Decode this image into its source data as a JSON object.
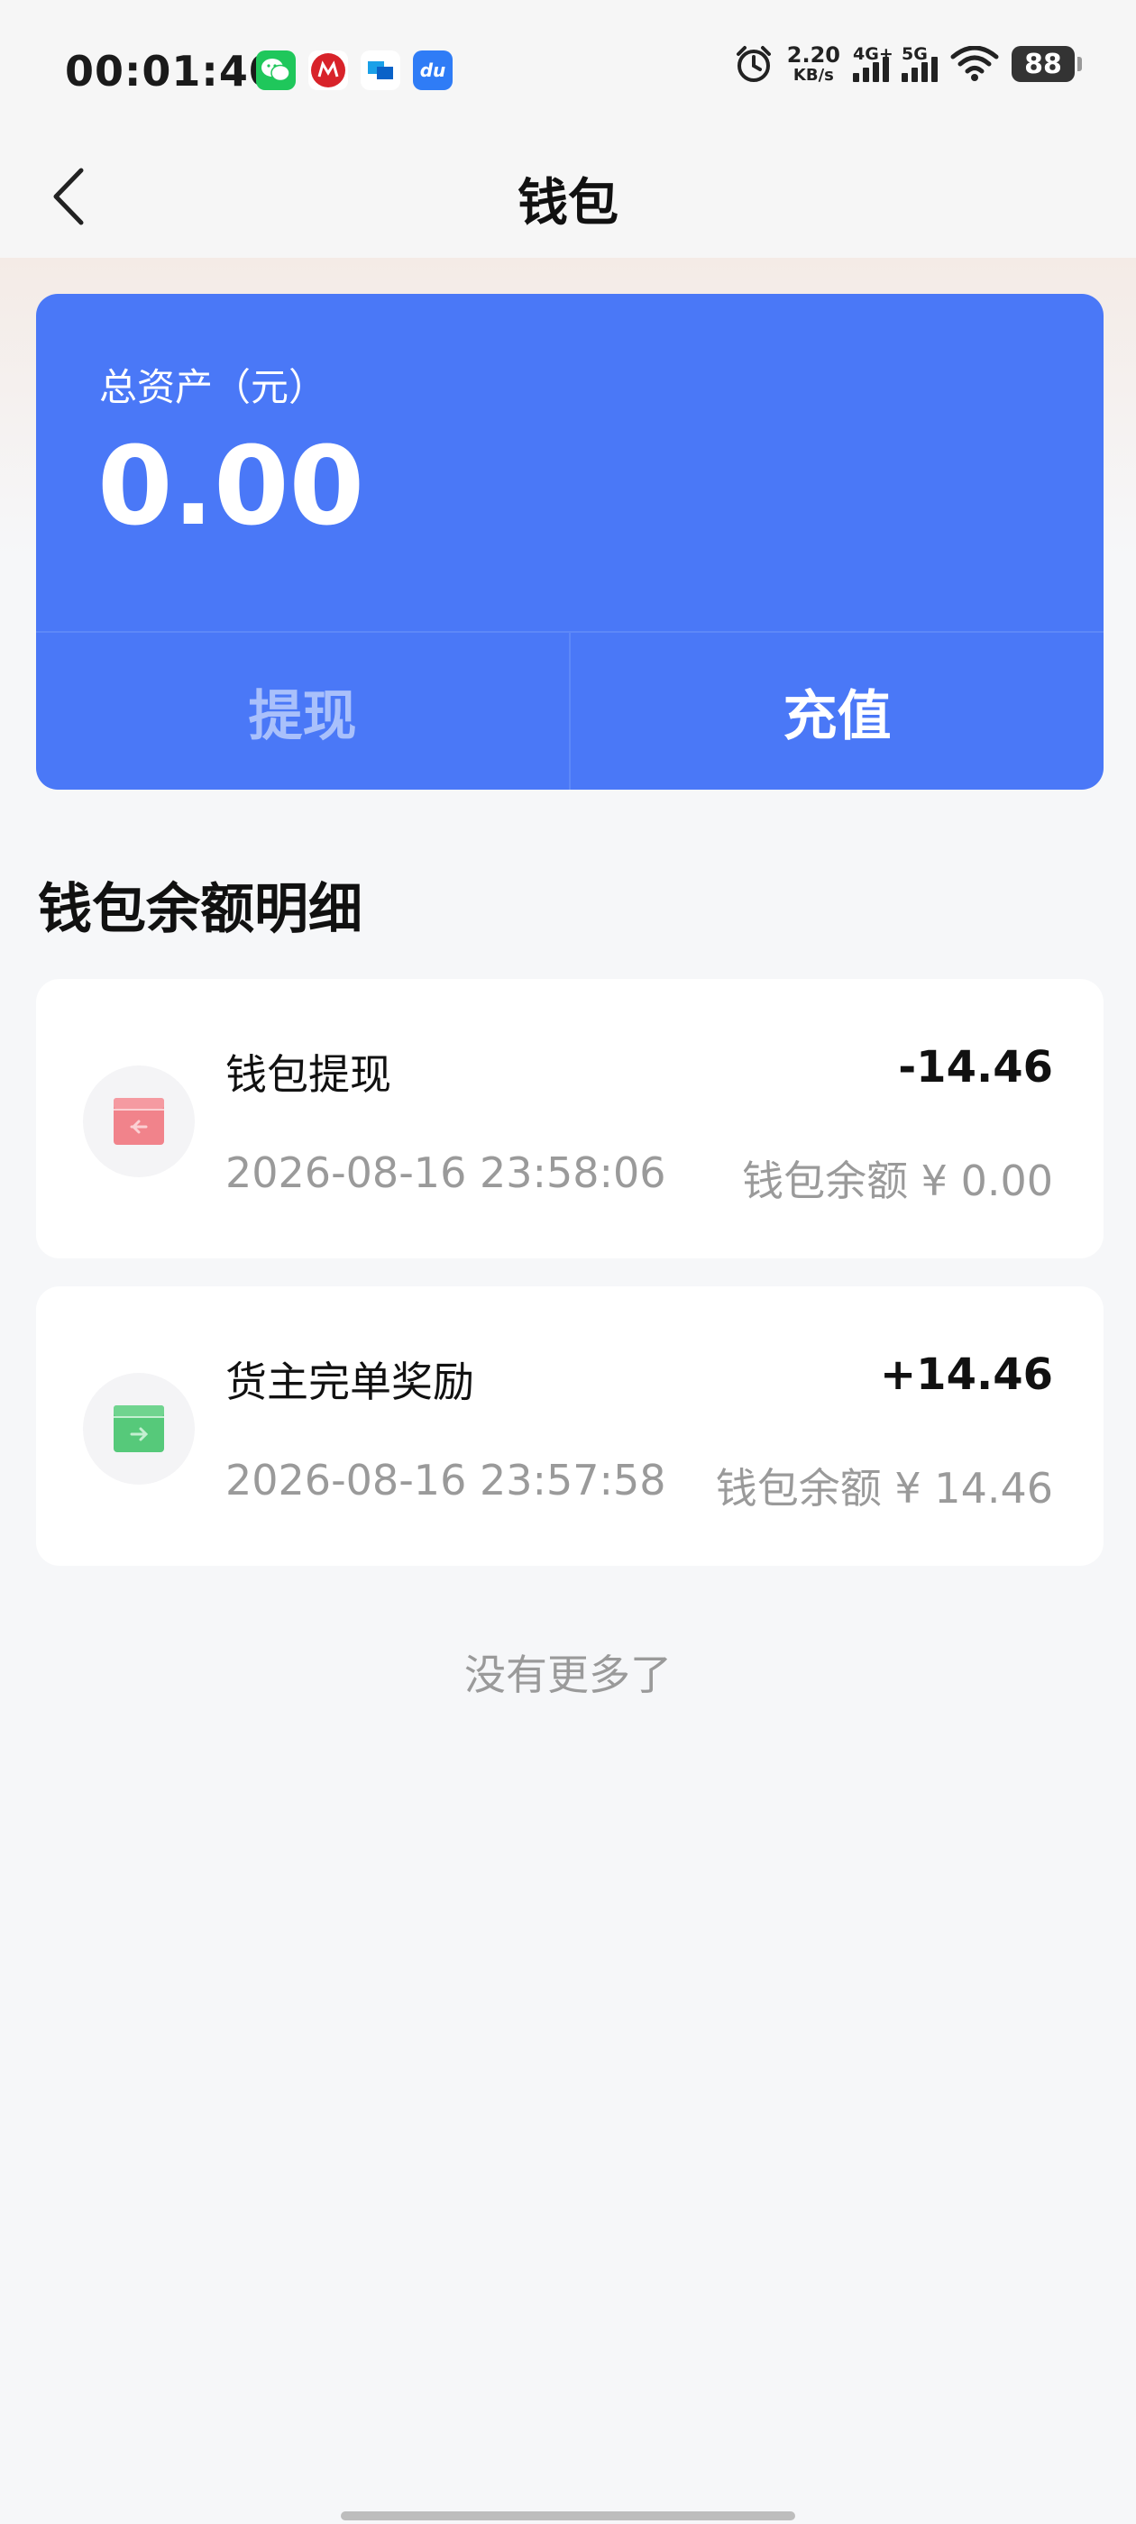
{
  "status_bar": {
    "time": "00:01:40",
    "net_speed_value": "2.20",
    "net_speed_unit": "KB/s",
    "signal1_label": "4G+",
    "signal2_label": "5G",
    "battery": "88",
    "notif_du": "du"
  },
  "nav": {
    "title": "钱包"
  },
  "asset": {
    "label": "总资产（元）",
    "amount": "0.00",
    "withdraw_label": "提现",
    "recharge_label": "充值"
  },
  "section": {
    "title": "钱包余额明细"
  },
  "transactions": [
    {
      "name": "钱包提现",
      "amount": "-14.46",
      "time": "2026-08-16 23:58:06",
      "balance": "钱包余额 ¥ 0.00",
      "icon": "withdraw-box-icon",
      "icon_color": "#f1838b"
    },
    {
      "name": "货主完单奖励",
      "amount": "+14.46",
      "time": "2026-08-16 23:57:58",
      "balance": "钱包余额 ¥ 14.46",
      "icon": "income-box-icon",
      "icon_color": "#56c97a"
    }
  ],
  "footer": {
    "no_more": "没有更多了"
  },
  "colors": {
    "card_blue": "#4a78f7",
    "withdraw_text": "#a9c0fb",
    "muted_text": "#9a9a9a"
  }
}
